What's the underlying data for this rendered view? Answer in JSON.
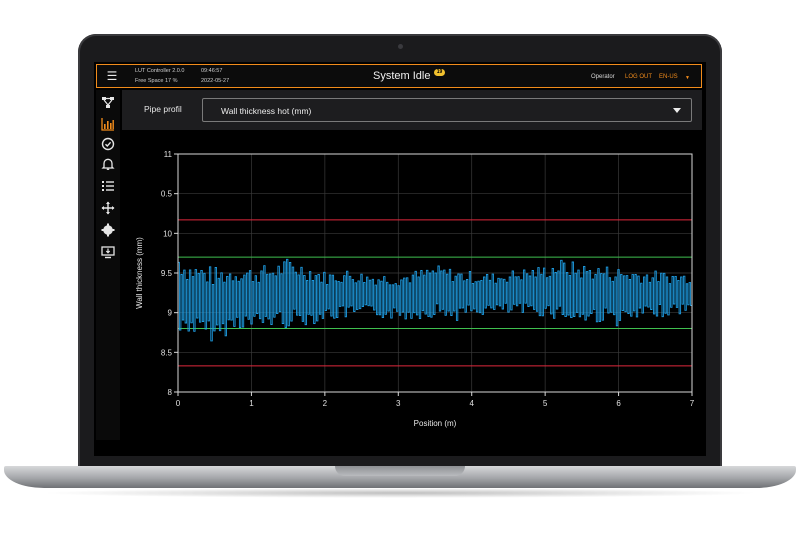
{
  "header": {
    "app_name": "LUT Controller 2.0.0",
    "time": "09:46:57",
    "free_space": "Free Space 17 %",
    "date": "2022-05-27",
    "title": "System Idle",
    "badge": "19",
    "user_role": "Operator",
    "logout_label": "LOG OUT",
    "language": "EN-US"
  },
  "sidebar": {
    "items": [
      {
        "icon": "topology-icon",
        "active": false
      },
      {
        "icon": "bar-chart-icon",
        "active": true
      },
      {
        "icon": "check-circle-icon",
        "active": false
      },
      {
        "icon": "bell-icon",
        "active": false
      },
      {
        "icon": "list-icon",
        "active": false
      },
      {
        "icon": "move-arrows-icon",
        "active": false
      },
      {
        "icon": "settings-gear-icon",
        "active": false
      },
      {
        "icon": "monitor-download-icon",
        "active": false
      }
    ]
  },
  "toolbar": {
    "pipe_profile_label": "Pipe profil",
    "selected_measurement": "Wall thickness hot (mm)"
  },
  "colors": {
    "accent": "#f28c1b",
    "series": "#1e9be0",
    "tolerance_outer": "#e0283c",
    "tolerance_inner": "#3fbf4f"
  },
  "chart_data": {
    "type": "line",
    "xlabel": "Position (m)",
    "ylabel": "Wall thickness (mm)",
    "xlim": [
      0,
      7
    ],
    "ylim": [
      8,
      11
    ],
    "x_ticks": [
      "0",
      "1",
      "2",
      "3",
      "4",
      "5",
      "6",
      "7"
    ],
    "y_ticks": [
      "8",
      "8.5",
      "9",
      "9.5",
      "10",
      "0.5",
      "11"
    ],
    "y_tick_values": [
      8,
      8.5,
      9,
      9.5,
      10,
      10.5,
      11
    ],
    "grid": true,
    "reference_lines": [
      {
        "kind": "upper-limit",
        "value": 10.17,
        "color": "#e0283c"
      },
      {
        "kind": "upper-warning",
        "value": 9.7,
        "color": "#3fbf4f"
      },
      {
        "kind": "lower-warning",
        "value": 8.8,
        "color": "#3fbf4f"
      },
      {
        "kind": "lower-limit",
        "value": 8.33,
        "color": "#e0283c"
      }
    ],
    "series": [
      {
        "upper_envelope": {
          "x": [
            0,
            0.1,
            0.3,
            0.5,
            0.8,
            1.0,
            1.3,
            1.5,
            1.8,
            2.0,
            2.3,
            2.6,
            3.0,
            3.3,
            3.5,
            3.8,
            4.0,
            4.3,
            4.6,
            5.0,
            5.2,
            5.5,
            5.8,
            6.0,
            6.3,
            6.6,
            7.0
          ],
          "y": [
            9.8,
            9.65,
            9.62,
            9.58,
            9.6,
            9.58,
            9.62,
            9.7,
            9.6,
            9.52,
            9.55,
            9.5,
            9.5,
            9.55,
            9.6,
            9.55,
            9.52,
            9.5,
            9.55,
            9.6,
            9.68,
            9.62,
            9.6,
            9.58,
            9.55,
            9.52,
            9.5
          ]
        },
        "lower_envelope": {
          "x": [
            0,
            0.1,
            0.3,
            0.5,
            0.8,
            1.0,
            1.3,
            1.5,
            1.8,
            2.0,
            2.3,
            2.6,
            3.0,
            3.3,
            3.5,
            3.8,
            4.0,
            4.3,
            4.6,
            5.0,
            5.2,
            5.5,
            5.8,
            6.0,
            6.3,
            6.6,
            7.0
          ],
          "y": [
            8.62,
            8.75,
            8.68,
            8.62,
            8.8,
            8.78,
            8.82,
            8.8,
            8.85,
            8.9,
            8.92,
            8.95,
            8.9,
            8.92,
            8.95,
            8.9,
            8.95,
            8.98,
            8.96,
            8.95,
            8.9,
            8.85,
            8.88,
            8.82,
            8.9,
            8.95,
            9.0
          ]
        }
      }
    ]
  }
}
